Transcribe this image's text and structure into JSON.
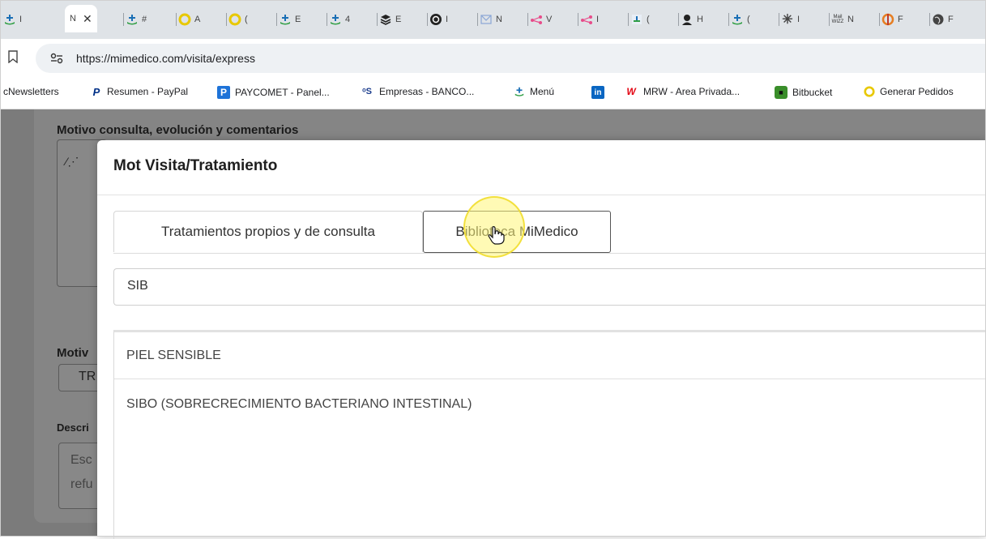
{
  "browser": {
    "tabs": [
      {
        "icon": "mimedico-icon",
        "label": "I"
      },
      {
        "icon": "generic-icon",
        "label": "N",
        "active": true
      },
      {
        "icon": "mimedico-icon",
        "label": "#"
      },
      {
        "icon": "yellow-ring-icon",
        "label": "A"
      },
      {
        "icon": "yellow-ring-icon",
        "label": "("
      },
      {
        "icon": "mimedico-icon",
        "label": "E"
      },
      {
        "icon": "mimedico-icon",
        "label": "4"
      },
      {
        "icon": "layers-icon",
        "label": "E"
      },
      {
        "icon": "spiral-icon",
        "label": "I"
      },
      {
        "icon": "mail-icon",
        "label": "N"
      },
      {
        "icon": "share-icon",
        "label": "V"
      },
      {
        "icon": "share-icon",
        "label": "I"
      },
      {
        "icon": "mimedico-bar-icon",
        "label": "("
      },
      {
        "icon": "avatar-icon",
        "label": "H"
      },
      {
        "icon": "mimedico-icon",
        "label": "("
      },
      {
        "icon": "asterisk-icon",
        "label": "I"
      },
      {
        "icon": "mailwizz-icon",
        "label": "N"
      },
      {
        "icon": "orange-logo-icon",
        "label": "F"
      },
      {
        "icon": "globe-icon",
        "label": "F"
      }
    ],
    "close_glyph": "✕",
    "url": "https://mimedico.com/visita/express",
    "mailwizz_text": "Mail\nWIZZ",
    "bookmarks": [
      {
        "icon": "partial-icon",
        "label": "cNewsletters"
      },
      {
        "icon": "paypal-icon",
        "label": "Resumen - PayPal"
      },
      {
        "icon": "paycomet-icon",
        "label": "PAYCOMET - Panel..."
      },
      {
        "icon": "banco-icon",
        "label": "Empresas - BANCO..."
      },
      {
        "icon": "mimedico-icon",
        "label": "Menú"
      },
      {
        "icon": "linkedin-icon",
        "label": ""
      },
      {
        "icon": "mrw-icon",
        "label": "MRW - Area Privada..."
      },
      {
        "icon": "bitbucket-icon",
        "label": "Bitbucket"
      },
      {
        "icon": "yellow-ring-icon",
        "label": "Generar Pedidos"
      }
    ]
  },
  "background_page": {
    "section_title": "Motivo consulta, evolución y comentarios",
    "motivo_label": "Motiv",
    "motivo_value": "TR",
    "descripcion_label": "Descri",
    "placeholder_line1": "Esc",
    "placeholder_line2": "refu"
  },
  "modal": {
    "title": "Mot Visita/Tratamiento",
    "tabs": [
      {
        "label": "Tratamientos propios y de consulta"
      },
      {
        "label": "Biblioteca MiMedico",
        "active": true
      }
    ],
    "search_value": "SIB",
    "results": [
      {
        "label": "PIEL SENSIBLE"
      },
      {
        "label": "SIBO (SOBRECRECIMIENTO BACTERIANO INTESTINAL)"
      }
    ]
  },
  "colors": {
    "mimedico_blue": "#1a6fb5",
    "mimedico_green": "#2f9e44",
    "yellow_ring": "#e8c800",
    "overlay": "#7b7b7b"
  }
}
